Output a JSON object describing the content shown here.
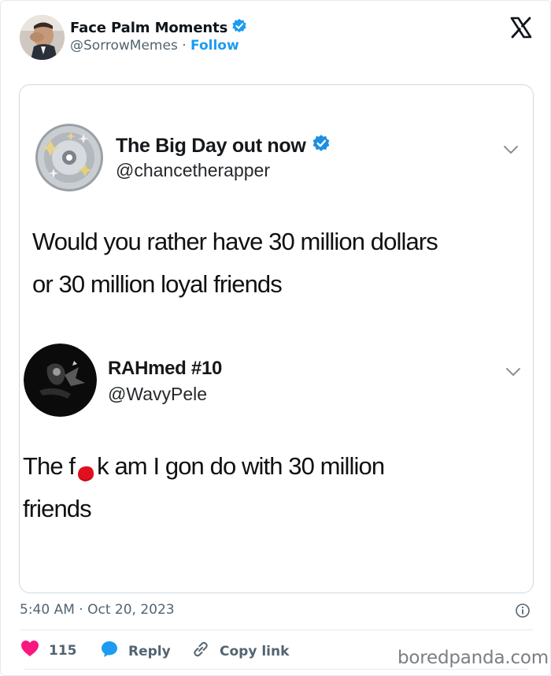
{
  "post": {
    "author_name": "Face Palm Moments",
    "handle": "@SorrowMemes",
    "separator": "·",
    "follow_label": "Follow",
    "timestamp": "5:40 AM · Oct 20, 2023"
  },
  "embedded": {
    "tweet1": {
      "name": "The Big Day out now",
      "handle": "@chancetherapper",
      "text_line1": "Would you rather have 30 million dollars",
      "text_line2": "or 30 million loyal friends"
    },
    "tweet2": {
      "name": "RAHmed #10",
      "handle": "@WavyPele",
      "text_line1_a": "The f",
      "text_line1_b": "k am I gon do with 30 million",
      "text_line2": "friends"
    }
  },
  "actions": {
    "like_count": "115",
    "reply_label": "Reply",
    "copy_label": "Copy link"
  },
  "watermark": "boredpanda.com",
  "colors": {
    "accent": "#1d9bf0",
    "like": "#f91880",
    "muted": "#536471",
    "redaction": "#e0101e"
  },
  "icons": [
    "verified-badge-icon",
    "x-logo-icon",
    "chevron-down-icon",
    "info-icon",
    "heart-icon",
    "reply-bubble-icon",
    "link-icon"
  ]
}
